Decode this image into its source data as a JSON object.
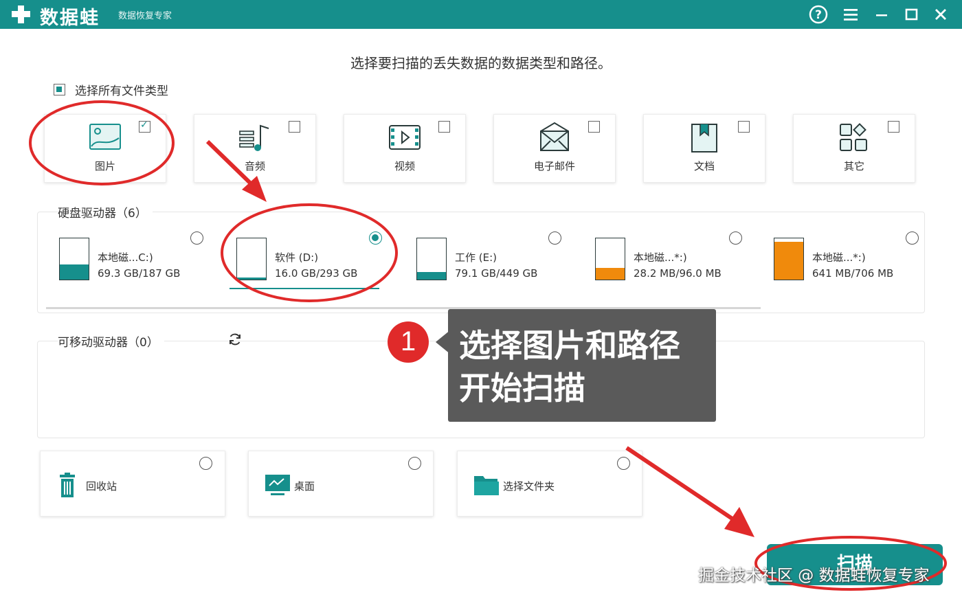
{
  "titlebar": {
    "app_name": "数据蛙",
    "app_sub": "数据恢复专家",
    "buttons": [
      "help-icon",
      "menu-icon",
      "minimize-icon",
      "maximize-icon",
      "close-icon"
    ]
  },
  "prompt": "选择要扫描的丢失数据的数据类型和路径。",
  "select_all": {
    "label": "选择所有文件类型",
    "state": "partial"
  },
  "file_types": [
    {
      "label": "图片",
      "icon": "image-icon",
      "checked": true
    },
    {
      "label": "音频",
      "icon": "audio-icon",
      "checked": false
    },
    {
      "label": "视频",
      "icon": "video-icon",
      "checked": false
    },
    {
      "label": "电子邮件",
      "icon": "email-icon",
      "checked": false
    },
    {
      "label": "文档",
      "icon": "document-icon",
      "checked": false
    },
    {
      "label": "其它",
      "icon": "other-icon",
      "checked": false
    }
  ],
  "hard_drives": {
    "title": "硬盘驱动器（6）",
    "items": [
      {
        "name": "本地磁...C:)",
        "size": "69.3 GB/187 GB",
        "used_fraction": 0.37,
        "color": "#168f8c",
        "selected": false
      },
      {
        "name": "软件 (D:)",
        "size": "16.0 GB/293 GB",
        "used_fraction": 0.05,
        "color": "#168f8c",
        "selected": true
      },
      {
        "name": "工作 (E:)",
        "size": "79.1 GB/449 GB",
        "used_fraction": 0.18,
        "color": "#168f8c",
        "selected": false
      },
      {
        "name": "本地磁...*:)",
        "size": "28.2 MB/96.0 MB",
        "used_fraction": 0.29,
        "color": "#f08a0c",
        "selected": false
      },
      {
        "name": "本地磁...*:)",
        "size": "641 MB/706 MB",
        "used_fraction": 0.91,
        "color": "#f08a0c",
        "selected": false
      }
    ]
  },
  "removable": {
    "title": "可移动驱动器（0）",
    "refresh_icon": "refresh-icon"
  },
  "locations": [
    {
      "label": "回收站",
      "icon": "trash-icon"
    },
    {
      "label": "桌面",
      "icon": "desktop-icon"
    },
    {
      "label": "选择文件夹",
      "icon": "folder-icon"
    }
  ],
  "scan_button": "扫描",
  "callout": {
    "number": "1",
    "line1": "选择图片和路径",
    "line2": "开始扫描"
  },
  "watermark": "掘金技术社区 @ 数据蛙恢复专家",
  "colors": {
    "accent": "#168f8c",
    "orange": "#f08a0c",
    "annotation_red": "#e02a2a"
  }
}
